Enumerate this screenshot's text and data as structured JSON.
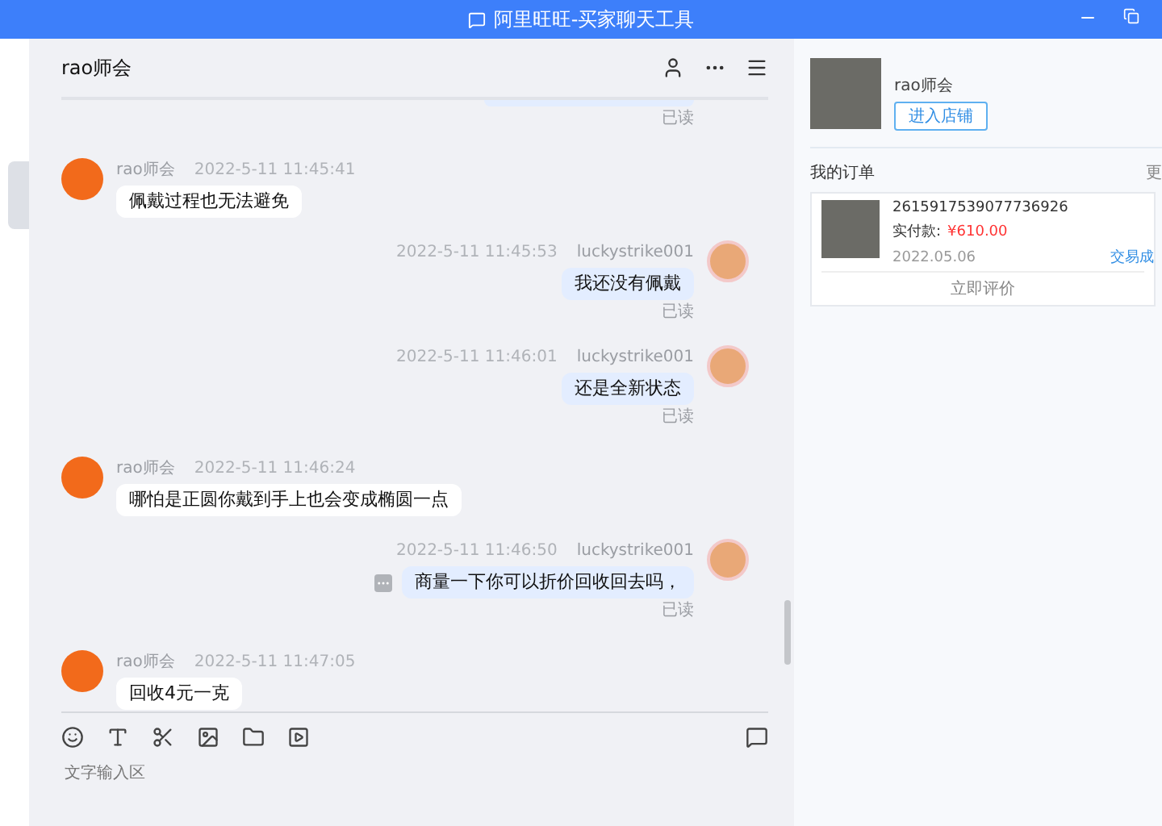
{
  "window": {
    "title": "阿里旺旺-买家聊天工具"
  },
  "chat": {
    "title": "rao师会",
    "messages": [
      {
        "kind": "receipt",
        "read": "已读"
      },
      {
        "kind": "incoming",
        "sender": "rao师会",
        "time": "2022-5-11 11:45:41",
        "text": "佩戴过程也无法避免"
      },
      {
        "kind": "outgoing",
        "sender": "luckystrike001",
        "time": "2022-5-11 11:45:53",
        "text": "我还没有佩戴",
        "read": "已读"
      },
      {
        "kind": "outgoing",
        "sender": "luckystrike001",
        "time": "2022-5-11 11:46:01",
        "text": "还是全新状态",
        "read": "已读"
      },
      {
        "kind": "incoming",
        "sender": "rao师会",
        "time": "2022-5-11 11:46:24",
        "text": "哪怕是正圆你戴到手上也会变成椭圆一点"
      },
      {
        "kind": "outgoing",
        "sender": "luckystrike001",
        "time": "2022-5-11 11:46:50",
        "text": "商量一下你可以折价回收回去吗，",
        "read": "已读",
        "more": true
      },
      {
        "kind": "incoming",
        "sender": "rao师会",
        "time": "2022-5-11 11:47:05",
        "text": "回收4元一克"
      }
    ],
    "input": {
      "placeholder": "文字输入区"
    }
  },
  "shop": {
    "name": "rao师会",
    "button": "进入店铺"
  },
  "orders": {
    "title": "我的订单",
    "more": "更",
    "items": [
      {
        "number": "2615917539077736926",
        "paid_label": "实付款:",
        "amount": "¥610.00",
        "date": "2022.05.06",
        "status": "交易成",
        "action": "立即评价"
      }
    ]
  }
}
